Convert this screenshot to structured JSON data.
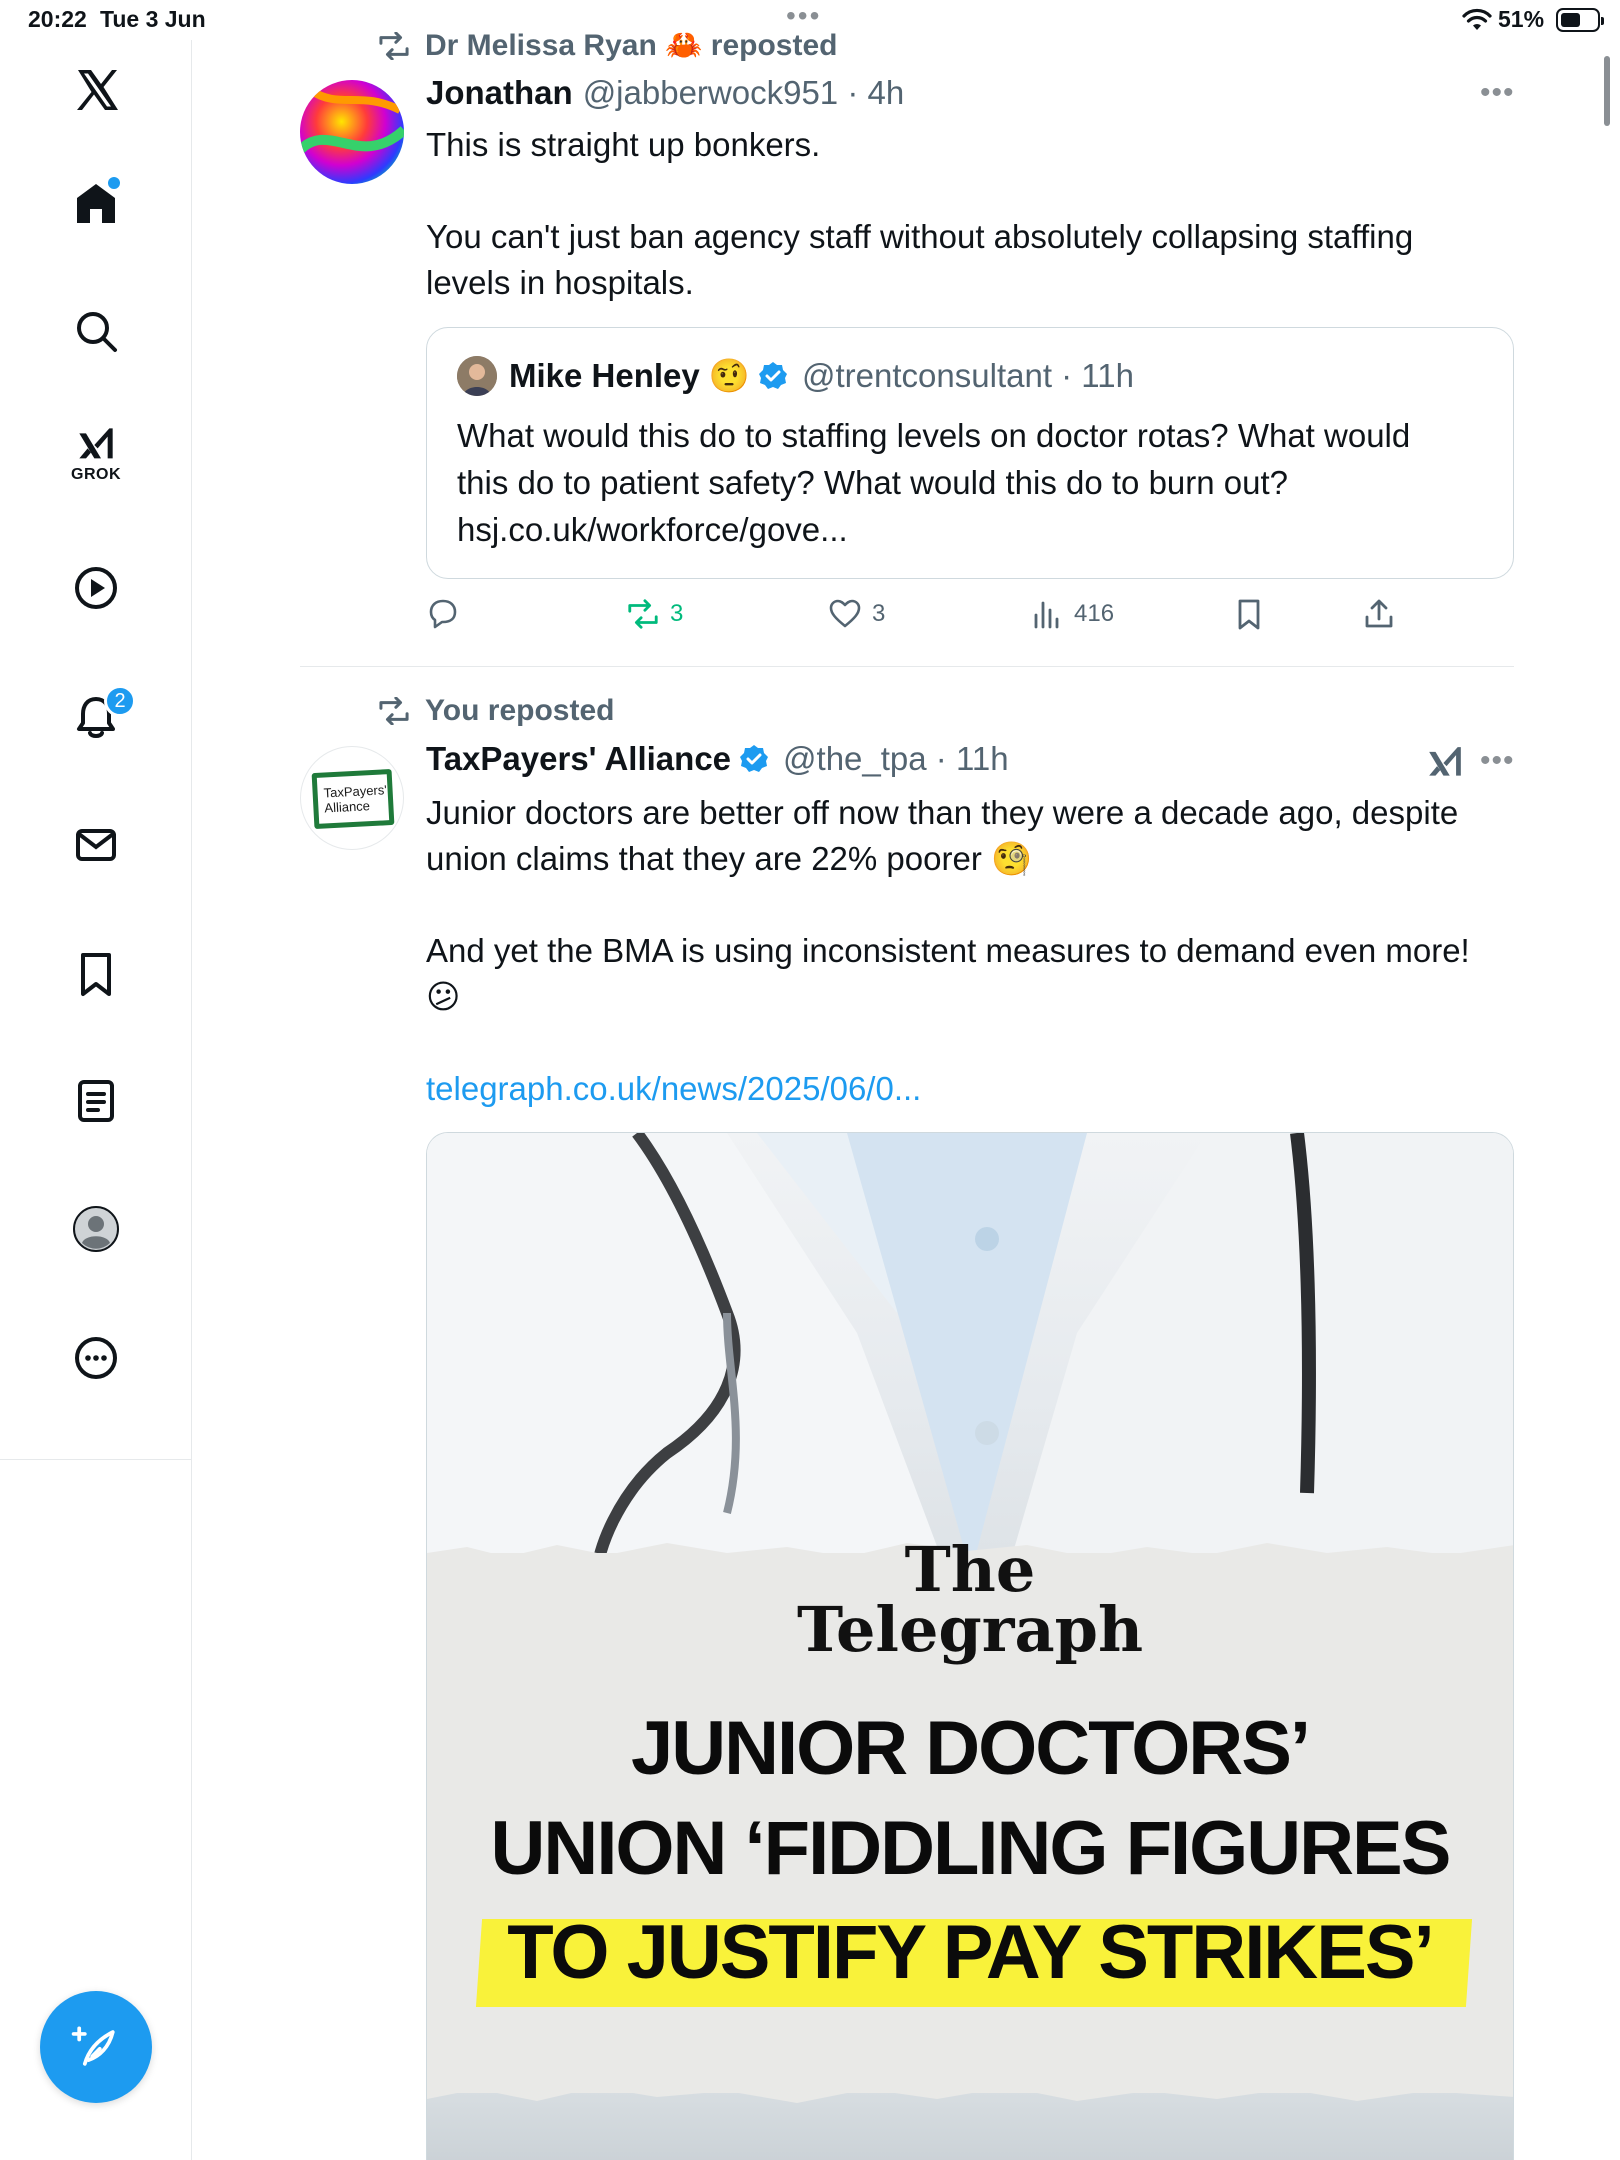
{
  "status_bar": {
    "time": "20:22",
    "date": "Tue 3 Jun",
    "battery": "51%"
  },
  "sidebar": {
    "items": [
      {
        "icon": "x-logo-icon"
      },
      {
        "icon": "home-icon"
      },
      {
        "icon": "search-icon"
      },
      {
        "icon": "grok-icon",
        "label": "GROK"
      },
      {
        "icon": "video-icon"
      },
      {
        "icon": "notifications-icon",
        "badge": "2"
      },
      {
        "icon": "messages-icon"
      },
      {
        "icon": "bookmarks-icon"
      },
      {
        "icon": "lists-icon"
      },
      {
        "icon": "profile-icon"
      },
      {
        "icon": "more-icon"
      }
    ],
    "compose_icon": "compose-icon"
  },
  "tweets": [
    {
      "repost_by": "Dr Melissa Ryan 🦀 reposted",
      "name": "Jonathan",
      "meta": "@jabberwock951 · 4h",
      "lines": [
        "This is straight up bonkers.",
        "You can't just ban agency staff without absolutely collapsing staffing",
        "levels in hospitals."
      ],
      "quote": {
        "name": "Mike Henley 🤨",
        "meta": "@trentconsultant · 11h",
        "lines": [
          "What would this do to staffing levels on doctor rotas? What would",
          "this do to patient safety? What would this do to burn out?",
          "hsj.co.uk/workforce/gove..."
        ]
      },
      "actions": {
        "reply": "",
        "repost": "3",
        "like": "3",
        "views": "416"
      }
    },
    {
      "repost_by": "You reposted",
      "name": "TaxPayers' Alliance",
      "meta": "@the_tpa · 11h",
      "avatar_text_1": "TaxPayers'",
      "avatar_text_2": "Alliance",
      "lines": [
        "Junior doctors are better off now than they were a decade ago, despite",
        "union claims that they are 22% poorer 🧐",
        "And yet the BMA is using inconsistent measures to demand even more!",
        "😕"
      ],
      "link": "telegraph.co.uk/news/2025/06/0...",
      "media": {
        "logo_1": "The",
        "logo_2": "Telegraph",
        "headline_1": "JUNIOR DOCTORS’",
        "headline_2": "UNION ‘FIDDLING FIGURES",
        "headline_3": "TO JUSTIFY PAY STRIKES’"
      }
    }
  ],
  "colors": {
    "accent": "#1d9bf0",
    "repost_green": "#00ba7c",
    "secondary_text": "#536471",
    "highlight_yellow": "#f9f23a"
  }
}
